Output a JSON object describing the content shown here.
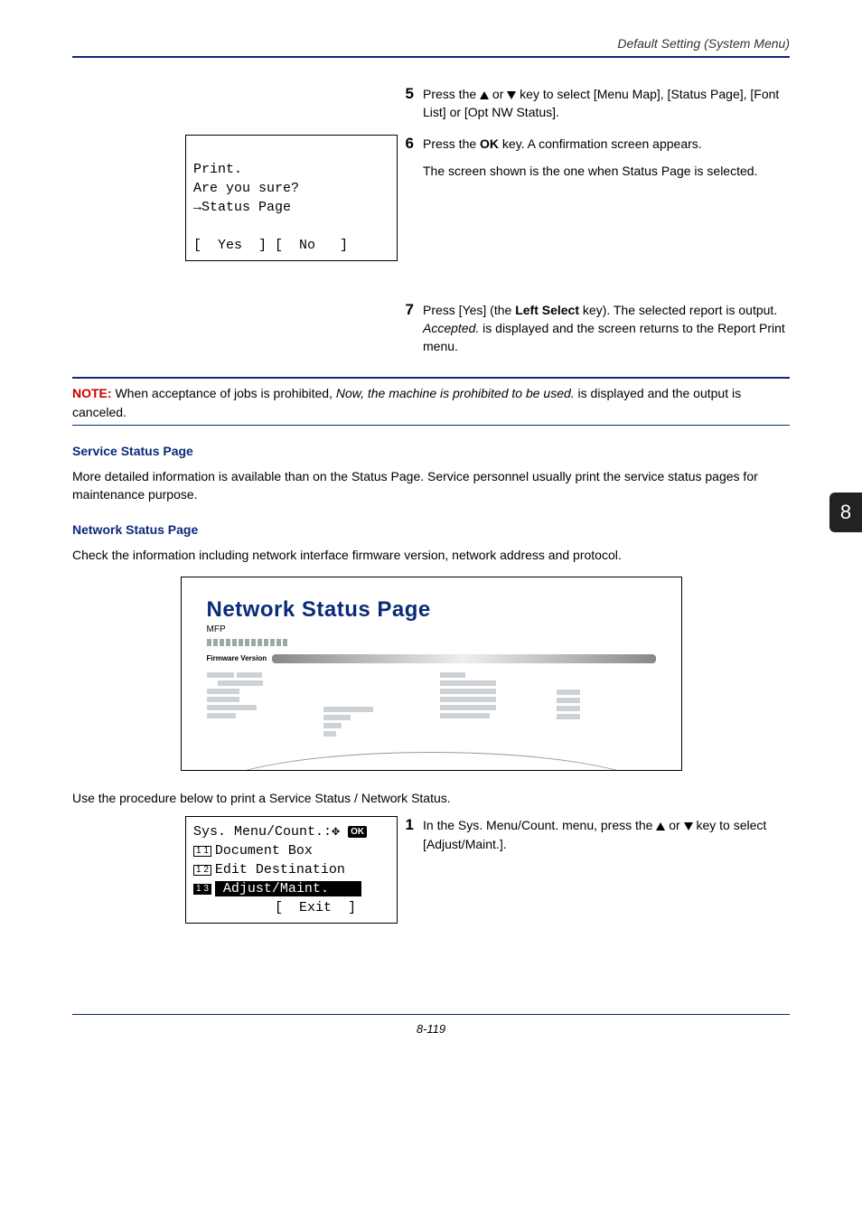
{
  "header": {
    "text": "Default Setting (System Menu)"
  },
  "sideTab": {
    "label": "8"
  },
  "lcd1": {
    "l1": "Print.",
    "l2": "Are you sure?",
    "arrow": "→",
    "l3": "Status Page",
    "yes": "[  Yes  ]",
    "no": "[  No   ]"
  },
  "steps_top": [
    {
      "n": "5",
      "pre": "Press the ",
      "post": " key to select [Menu Map], [Status Page], [Font List] or [Opt NW Status]."
    },
    {
      "n": "6",
      "t1": "Press the ",
      "bold": "OK",
      "t2": " key. A confirmation screen appears.",
      "sub": "The screen shown is the one when Status Page is selected."
    },
    {
      "n": "7",
      "t1": "Press [Yes] (the ",
      "bold": "Left Select",
      "t2": " key). The selected report is output. ",
      "it": "Accepted.",
      "t3": " is displayed and the screen returns to the Report Print menu."
    }
  ],
  "note": {
    "label": "NOTE:",
    "t1": " When acceptance of jobs is prohibited, ",
    "it": "Now, the machine is prohibited to be used.",
    "t2": " is displayed and the output is canceled."
  },
  "sections": {
    "svc_title": "Service Status Page",
    "svc_body": "More detailed information is available than on the Status Page. Service personnel usually print the service status pages for maintenance purpose.",
    "net_title": "Network Status Page",
    "net_body": "Check the information including network interface firmware version, network address and protocol."
  },
  "nsp": {
    "title": "Network Status Page",
    "sub": "MFP",
    "fw": "Firmware Version"
  },
  "proc_intro": "Use the procedure below to print a Service Status / Network Status.",
  "lcd2": {
    "title": "Sys. Menu/Count.:",
    "i11": "Document Box",
    "i12": "Edit Destination",
    "i13": "Adjust/Maint.",
    "exit": "[  Exit  ]"
  },
  "step_bottom": {
    "n": "1",
    "t1": "In the Sys. Menu/Count. menu, press the ",
    "t2": " key to select [Adjust/Maint.]."
  },
  "footer": {
    "pg": "8-119"
  }
}
